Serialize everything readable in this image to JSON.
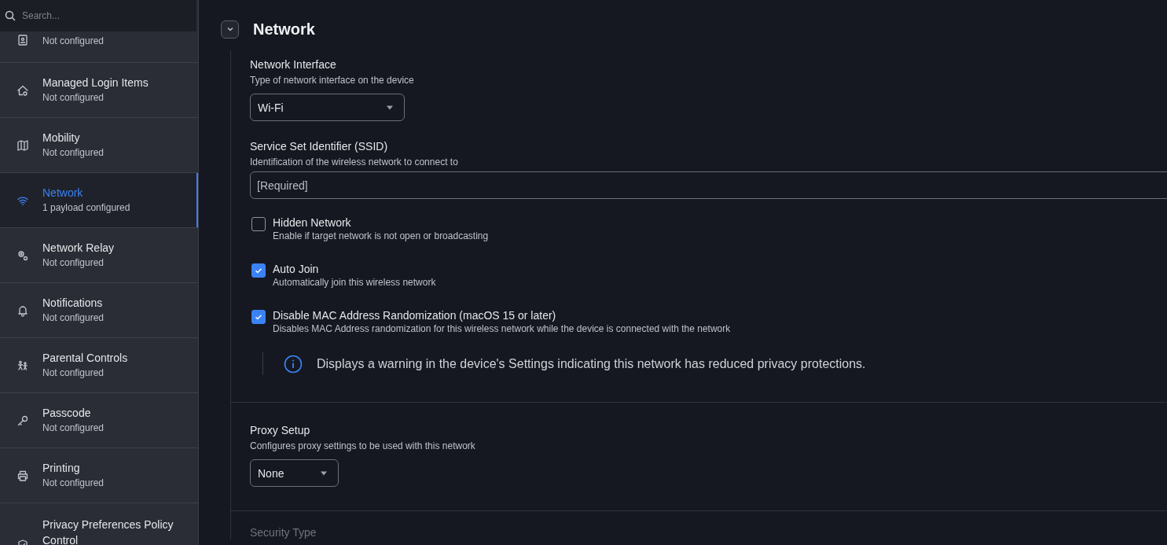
{
  "search": {
    "placeholder": "Search..."
  },
  "sidebar": {
    "items": [
      {
        "subtitle": "Not configured",
        "selected": false
      },
      {
        "title": "Managed Login Items",
        "subtitle": "Not configured",
        "selected": false
      },
      {
        "title": "Mobility",
        "subtitle": "Not configured",
        "selected": false
      },
      {
        "title": "Network",
        "subtitle": "1 payload configured",
        "selected": true
      },
      {
        "title": "Network Relay",
        "subtitle": "Not configured",
        "selected": false
      },
      {
        "title": "Notifications",
        "subtitle": "Not configured",
        "selected": false
      },
      {
        "title": "Parental Controls",
        "subtitle": "Not configured",
        "selected": false
      },
      {
        "title": "Passcode",
        "subtitle": "Not configured",
        "selected": false
      },
      {
        "title": "Printing",
        "subtitle": "Not configured",
        "selected": false
      },
      {
        "title": "Privacy Preferences Policy Control",
        "selected": false
      }
    ]
  },
  "section": {
    "title": "Network",
    "expanded": true
  },
  "groups": [
    {
      "fields": [
        {
          "kind": "select",
          "label": "Network Interface",
          "description": "Type of network interface on the device",
          "value": "Wi-Fi"
        },
        {
          "kind": "text",
          "label": "Service Set Identifier (SSID)",
          "description": "Identification of the wireless network to connect to",
          "placeholder": "[Required]"
        },
        {
          "kind": "checkbox",
          "label": "Hidden Network",
          "description": "Enable if target network is not open or broadcasting",
          "checked": false
        },
        {
          "kind": "checkbox",
          "label": "Auto Join",
          "description": "Automatically join this wireless network",
          "checked": true
        },
        {
          "kind": "checkbox",
          "label": "Disable MAC Address Randomization (macOS 15 or later)",
          "description": "Disables MAC Address randomization for this wireless network while the device is connected with the network",
          "checked": true
        },
        {
          "kind": "note",
          "text": "Displays a warning in the device's Settings indicating this network has reduced privacy protections."
        }
      ]
    },
    {
      "fields": [
        {
          "kind": "select",
          "label": "Proxy Setup",
          "description": "Configures proxy settings to be used with this network",
          "value": "None"
        }
      ]
    },
    {
      "fields": [
        {
          "kind": "heading",
          "label": "Security Type"
        }
      ]
    }
  ]
}
